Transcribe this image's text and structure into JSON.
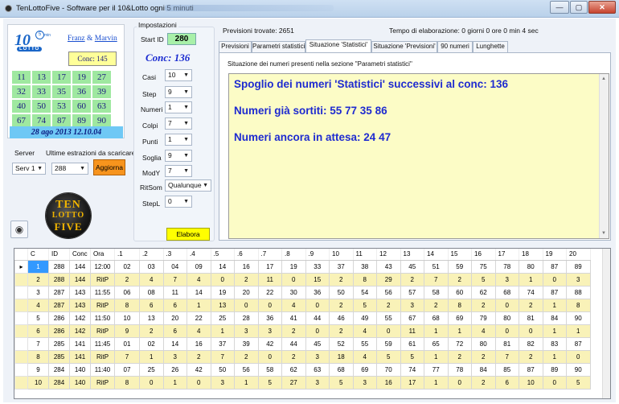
{
  "window": {
    "title": "TenLottoFive - Software per il 10&Lotto ogni 5 minuti",
    "minimize": "—",
    "maximize": "▢",
    "close": "✕"
  },
  "logo": {
    "ten": "10",
    "five": "5",
    "min": "min",
    "lotto": "LOTTO",
    "author1": "Franz",
    "amp": " & ",
    "author2": "Marvin",
    "conc": "Conc: 145",
    "numbers": [
      "11",
      "13",
      "17",
      "19",
      "27",
      "32",
      "33",
      "35",
      "36",
      "39",
      "40",
      "50",
      "53",
      "60",
      "63",
      "67",
      "74",
      "87",
      "89",
      "90"
    ],
    "date": "28 ago 2013 12.10.04"
  },
  "server": {
    "label": "Server",
    "download_label": "Ultime estrazioni da scaricare",
    "server_value": "Serv 1",
    "count_value": "288",
    "update_button": "Aggiorna"
  },
  "tenlogo": {
    "line1": "TEN",
    "line2": "LOTTO",
    "line3": "FIVE"
  },
  "settings": {
    "group_label": "Impostazioni",
    "start_id_label": "Start ID",
    "start_id": "280",
    "conc": "Conc: 136",
    "casi_label": "Casi",
    "casi": "10",
    "step_label": "Step",
    "step": "9",
    "numeri_label": "Numeri",
    "numeri": "1",
    "colpi_label": "Colpi",
    "colpi": "7",
    "punti_label": "Punti",
    "punti": "1",
    "soglia_label": "Soglia",
    "soglia": "9",
    "mody_label": "ModY",
    "mody": "7",
    "ritsom_label": "RitSom",
    "ritsom": "Qualunque",
    "stepl_label": "StepL",
    "stepl": "0",
    "elabora_button": "Elabora"
  },
  "status": {
    "previsioni": "Previsioni trovate: 2651",
    "tempo": "Tempo di elaborazione: 0 giorni 0 ore 0 min 4 sec"
  },
  "tabs": [
    "Previsioni",
    "Parametri statistici",
    "Situazione 'Statistici'",
    "Situazione 'Previsioni'",
    "90 numeri",
    "Lunghette"
  ],
  "pane": {
    "subtitle": "Situazione dei numeri presenti nella sezione  \"Parametri statistici\"",
    "line1": "Spoglio dei numeri 'Statistici' successivi al conc: 136",
    "line2": "Numeri già sortiti: 55 77 35 86",
    "line3": "Numeri ancora in attesa: 24 47"
  },
  "table": {
    "headers": [
      "C",
      "ID",
      "Conc",
      "Ora",
      ".1",
      ".2",
      ".3",
      ".4",
      ".5",
      ".6",
      ".7",
      ".8",
      ".9",
      "10",
      "11",
      "12",
      "13",
      "14",
      "15",
      "16",
      "17",
      "18",
      "19",
      "20"
    ],
    "rows": [
      [
        "1",
        "288",
        "144",
        "12:00",
        "02",
        "03",
        "04",
        "09",
        "14",
        "16",
        "17",
        "19",
        "33",
        "37",
        "38",
        "43",
        "45",
        "51",
        "59",
        "75",
        "78",
        "80",
        "87",
        "89"
      ],
      [
        "2",
        "288",
        "144",
        "RitP",
        "2",
        "4",
        "7",
        "4",
        "0",
        "2",
        "11",
        "0",
        "15",
        "2",
        "8",
        "29",
        "2",
        "7",
        "2",
        "5",
        "3",
        "1",
        "0",
        "3"
      ],
      [
        "3",
        "287",
        "143",
        "11:55",
        "06",
        "08",
        "11",
        "14",
        "19",
        "20",
        "22",
        "30",
        "36",
        "50",
        "54",
        "56",
        "57",
        "58",
        "60",
        "62",
        "68",
        "74",
        "87",
        "88"
      ],
      [
        "4",
        "287",
        "143",
        "RitP",
        "8",
        "6",
        "6",
        "1",
        "13",
        "0",
        "0",
        "4",
        "0",
        "2",
        "5",
        "2",
        "3",
        "2",
        "8",
        "2",
        "0",
        "2",
        "1",
        "8"
      ],
      [
        "5",
        "286",
        "142",
        "11:50",
        "10",
        "13",
        "20",
        "22",
        "25",
        "28",
        "36",
        "41",
        "44",
        "46",
        "49",
        "55",
        "67",
        "68",
        "69",
        "79",
        "80",
        "81",
        "84",
        "90"
      ],
      [
        "6",
        "286",
        "142",
        "RitP",
        "9",
        "2",
        "6",
        "4",
        "1",
        "3",
        "3",
        "2",
        "0",
        "2",
        "4",
        "0",
        "11",
        "1",
        "1",
        "4",
        "0",
        "0",
        "1",
        "1"
      ],
      [
        "7",
        "285",
        "141",
        "11:45",
        "01",
        "02",
        "14",
        "16",
        "37",
        "39",
        "42",
        "44",
        "45",
        "52",
        "55",
        "59",
        "61",
        "65",
        "72",
        "80",
        "81",
        "82",
        "83",
        "87"
      ],
      [
        "8",
        "285",
        "141",
        "RitP",
        "7",
        "1",
        "3",
        "2",
        "7",
        "2",
        "0",
        "2",
        "3",
        "18",
        "4",
        "5",
        "5",
        "1",
        "2",
        "2",
        "7",
        "2",
        "1",
        "0"
      ],
      [
        "9",
        "284",
        "140",
        "11:40",
        "07",
        "25",
        "26",
        "42",
        "50",
        "56",
        "58",
        "62",
        "63",
        "68",
        "69",
        "70",
        "74",
        "77",
        "78",
        "84",
        "85",
        "87",
        "89",
        "90"
      ],
      [
        "10",
        "284",
        "140",
        "RitP",
        "8",
        "0",
        "1",
        "0",
        "3",
        "1",
        "5",
        "27",
        "3",
        "5",
        "3",
        "16",
        "17",
        "1",
        "0",
        "2",
        "6",
        "10",
        "0",
        "5"
      ]
    ]
  }
}
